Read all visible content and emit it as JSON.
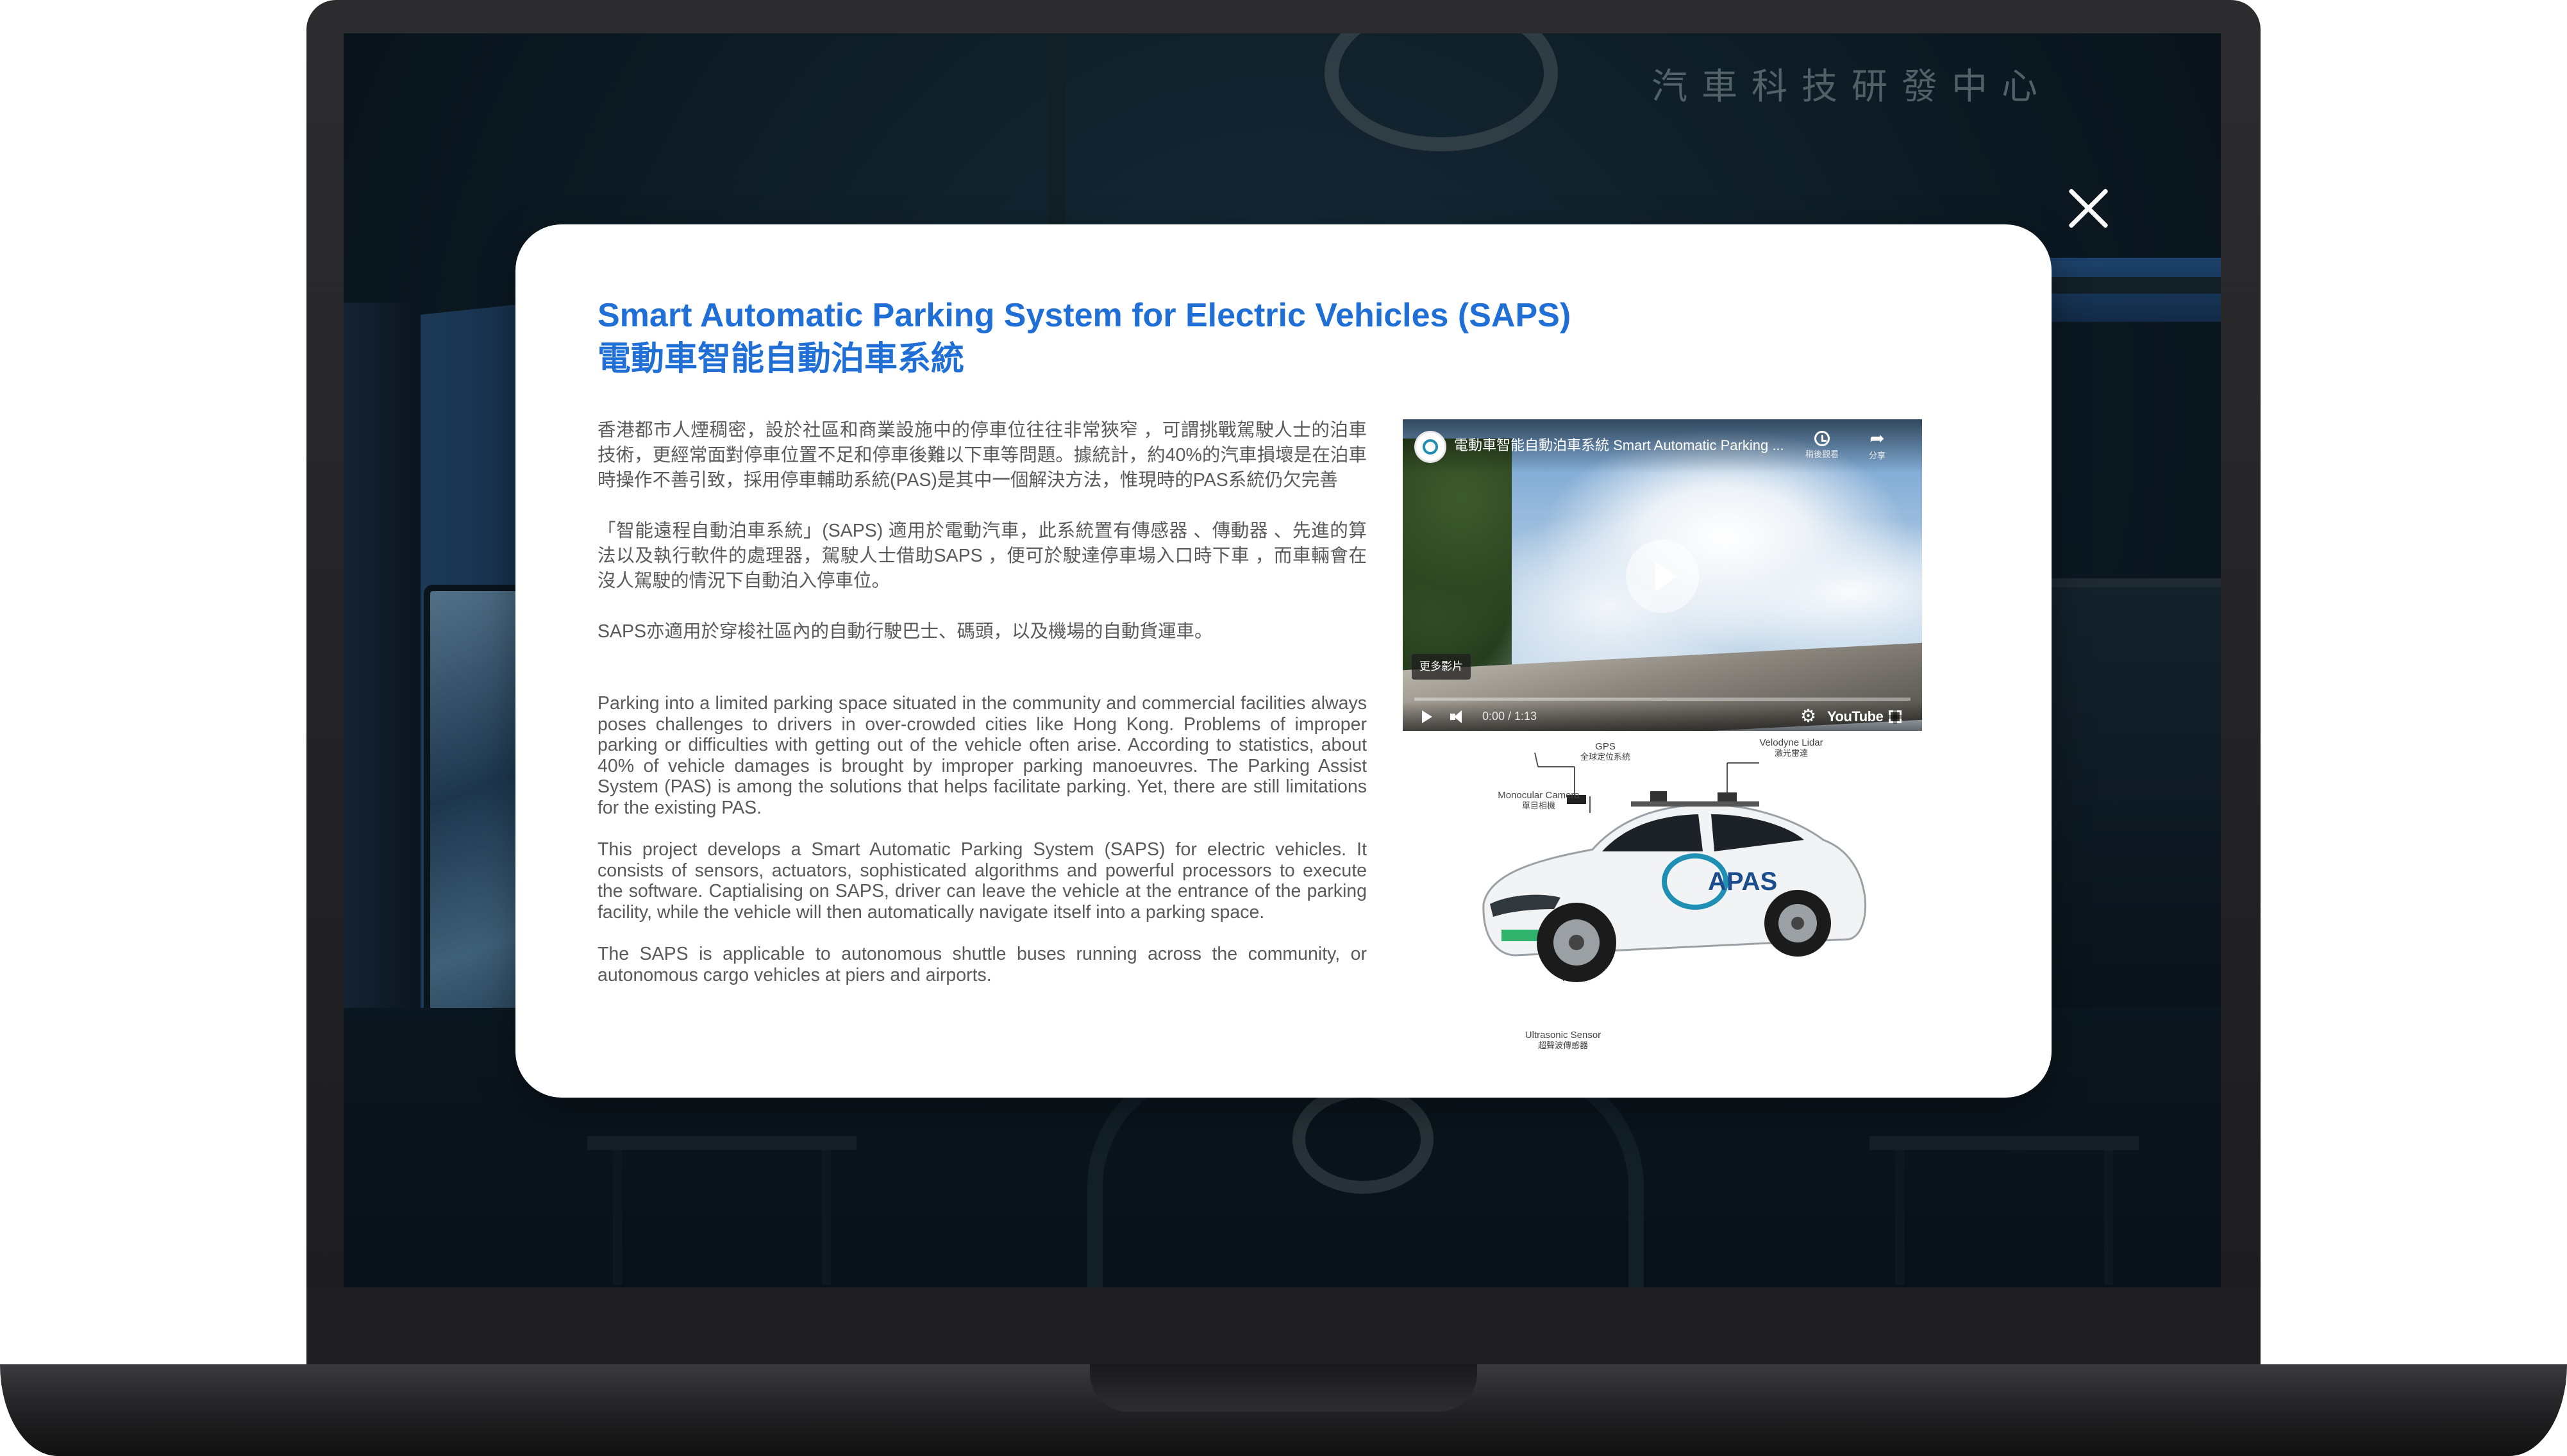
{
  "background": {
    "center_sign": "汽車科技研發中心"
  },
  "modal": {
    "title_en": "Smart Automatic Parking System for Electric Vehicles (SAPS)",
    "title_zh": "電動車智能自動泊車系統",
    "zh_paragraphs": [
      "香港都市人煙稠密，設於社區和商業設施中的停車位往往非常狹窄 ，可謂挑戰駕駛人士的泊車技術，更經常面對停車位置不足和停車後難以下車等問題。據統計，約40%的汽車損壞是在泊車時操作不善引致，採用停車輔助系統(PAS)是其中一個解決方法，惟現時的PAS系統仍欠完善",
      "「智能遠程自動泊車系統」(SAPS) 適用於電動汽車，此系統置有傳感器 、傳動器 、先進的算法以及執行軟件的處理器，駕駛人士借助SAPS ，便可於駛達停車場入口時下車 ，而車輛會在沒人駕駛的情況下自動泊入停車位。",
      "SAPS亦適用於穿梭社區內的自動行駛巴士、碼頭，以及機場的自動貨運車。"
    ],
    "en_paragraphs": [
      "Parking into a limited parking space situated in the community and commercial facilities always poses challenges to drivers in over-crowded cities like Hong Kong. Problems of improper parking or difficulties with getting out of the vehicle often arise. According to statistics, about 40% of vehicle damages is brought by improper parking manoeuvres. The Parking Assist System (PAS) is among the solutions that helps facilitate parking. Yet, there are still limitations for the existing PAS.",
      "This project develops a Smart Automatic Parking System (SAPS) for electric vehicles. It consists of sensors, actuators, sophisticated algorithms and powerful processors to execute the software. Captialising on SAPS, driver can leave the vehicle at the entrance of the parking facility, while the vehicle will then automatically navigate itself into a parking space.",
      "The SAPS is applicable to autonomous shuttle buses running across the community, or autonomous cargo vehicles at piers and airports."
    ]
  },
  "video": {
    "title": "電動車智能自動泊車系統 Smart Automatic Parking ...",
    "watch_later_label": "稍後觀看",
    "share_label": "分享",
    "more_videos_label": "更多影片",
    "time": "0:00 / 1:13",
    "brand": "YouTube",
    "progress": 0
  },
  "car_diagram": {
    "gps_en": "GPS",
    "gps_zh": "全球定位系統",
    "lidar_en": "Velodyne Lidar",
    "lidar_zh": "激光雷達",
    "camera_en": "Monocular Camera",
    "camera_zh": "單目相機",
    "ultrasonic_en": "Ultrasonic Sensor",
    "ultrasonic_zh": "超聲波傳感器",
    "car_logo_text": "APAS"
  },
  "colors": {
    "title_blue": "#1f6fd6",
    "body_text": "#5a5a5a",
    "car_body": "#f2f3f4",
    "plate_green": "#2fb36d"
  }
}
